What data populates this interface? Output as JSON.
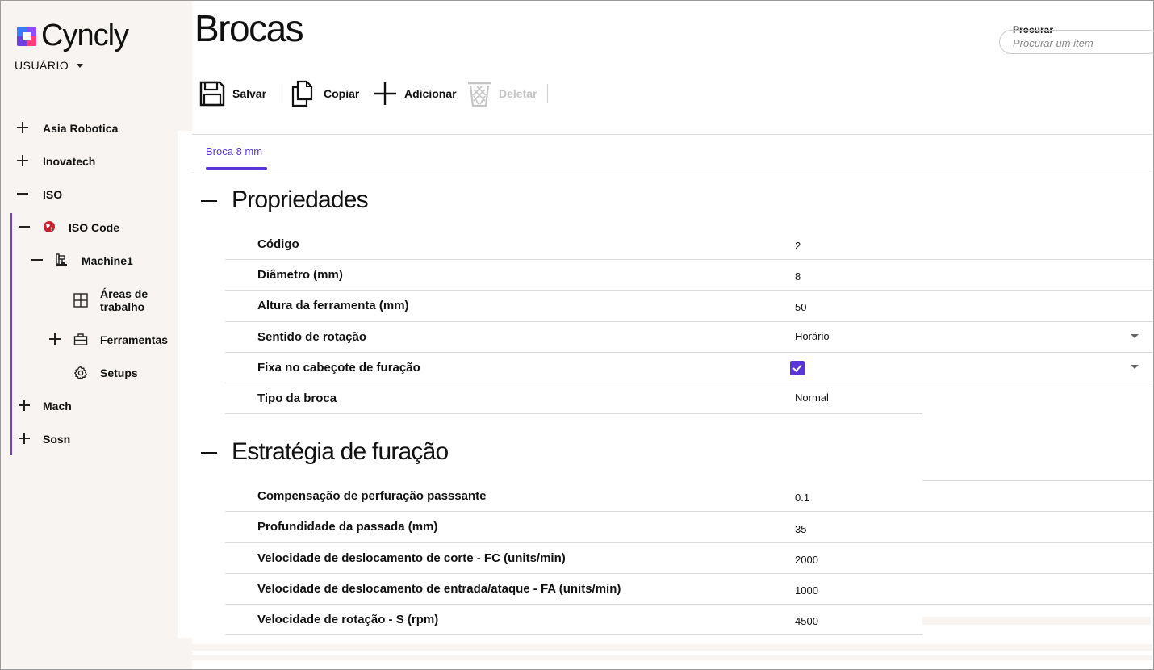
{
  "app": {
    "logo_text": "Cyncly",
    "user_menu": "USUÁRIO"
  },
  "sidebar": {
    "items": [
      {
        "label": "Asia Robotica",
        "toggle": "plus"
      },
      {
        "label": "Inovatech",
        "toggle": "plus"
      },
      {
        "label": "ISO",
        "toggle": "minus"
      },
      {
        "label": "ISO Code",
        "toggle": "minus",
        "icon": "globe-icon"
      },
      {
        "label": "Machine1",
        "toggle": "minus",
        "icon": "machine-icon"
      },
      {
        "label": "Áreas de trabalho",
        "icon": "grid-icon"
      },
      {
        "label": "Ferramentas",
        "toggle": "plus",
        "icon": "briefcase-icon"
      },
      {
        "label": "Setups",
        "icon": "gear-icon"
      },
      {
        "label": "Mach",
        "toggle": "plus"
      },
      {
        "label": "Sosn",
        "toggle": "plus"
      }
    ],
    "accent_color": "#6b3fe0"
  },
  "header": {
    "title": "Brocas"
  },
  "search": {
    "label": "Procurar",
    "placeholder": "Procurar um item"
  },
  "toolbar": {
    "save_label": "Salvar",
    "copy_label": "Copiar",
    "add_label": "Adicionar",
    "delete_label": "Deletar"
  },
  "tabs": [
    {
      "label": "Broca 8 mm",
      "active": true
    }
  ],
  "sections": {
    "properties": {
      "title": "Propriedades",
      "rows": [
        {
          "label": "Código",
          "value": "2"
        },
        {
          "label": "Diâmetro (mm)",
          "value": "8"
        },
        {
          "label": "Altura da ferramenta (mm)",
          "value": "50"
        },
        {
          "label": "Sentido de rotação",
          "value": "Horário"
        },
        {
          "label": "Fixa no cabeçote de furação",
          "checked": true
        },
        {
          "label": "Tipo da broca",
          "value": "Normal"
        }
      ]
    },
    "strategy": {
      "title": "Estratégia de furação",
      "rows": [
        {
          "label": "Compensação de perfuração passsante",
          "value": "0.1"
        },
        {
          "label": "Profundidade da passada (mm)",
          "value": "35"
        },
        {
          "label": "Velocidade de deslocamento de corte - FC (units/min)",
          "value": "2000"
        },
        {
          "label": "Velocidade de deslocamento de entrada/ataque - FA (units/min)",
          "value": "1000"
        },
        {
          "label": "Velocidade de rotação - S (rpm)",
          "value": "4500"
        }
      ]
    }
  }
}
